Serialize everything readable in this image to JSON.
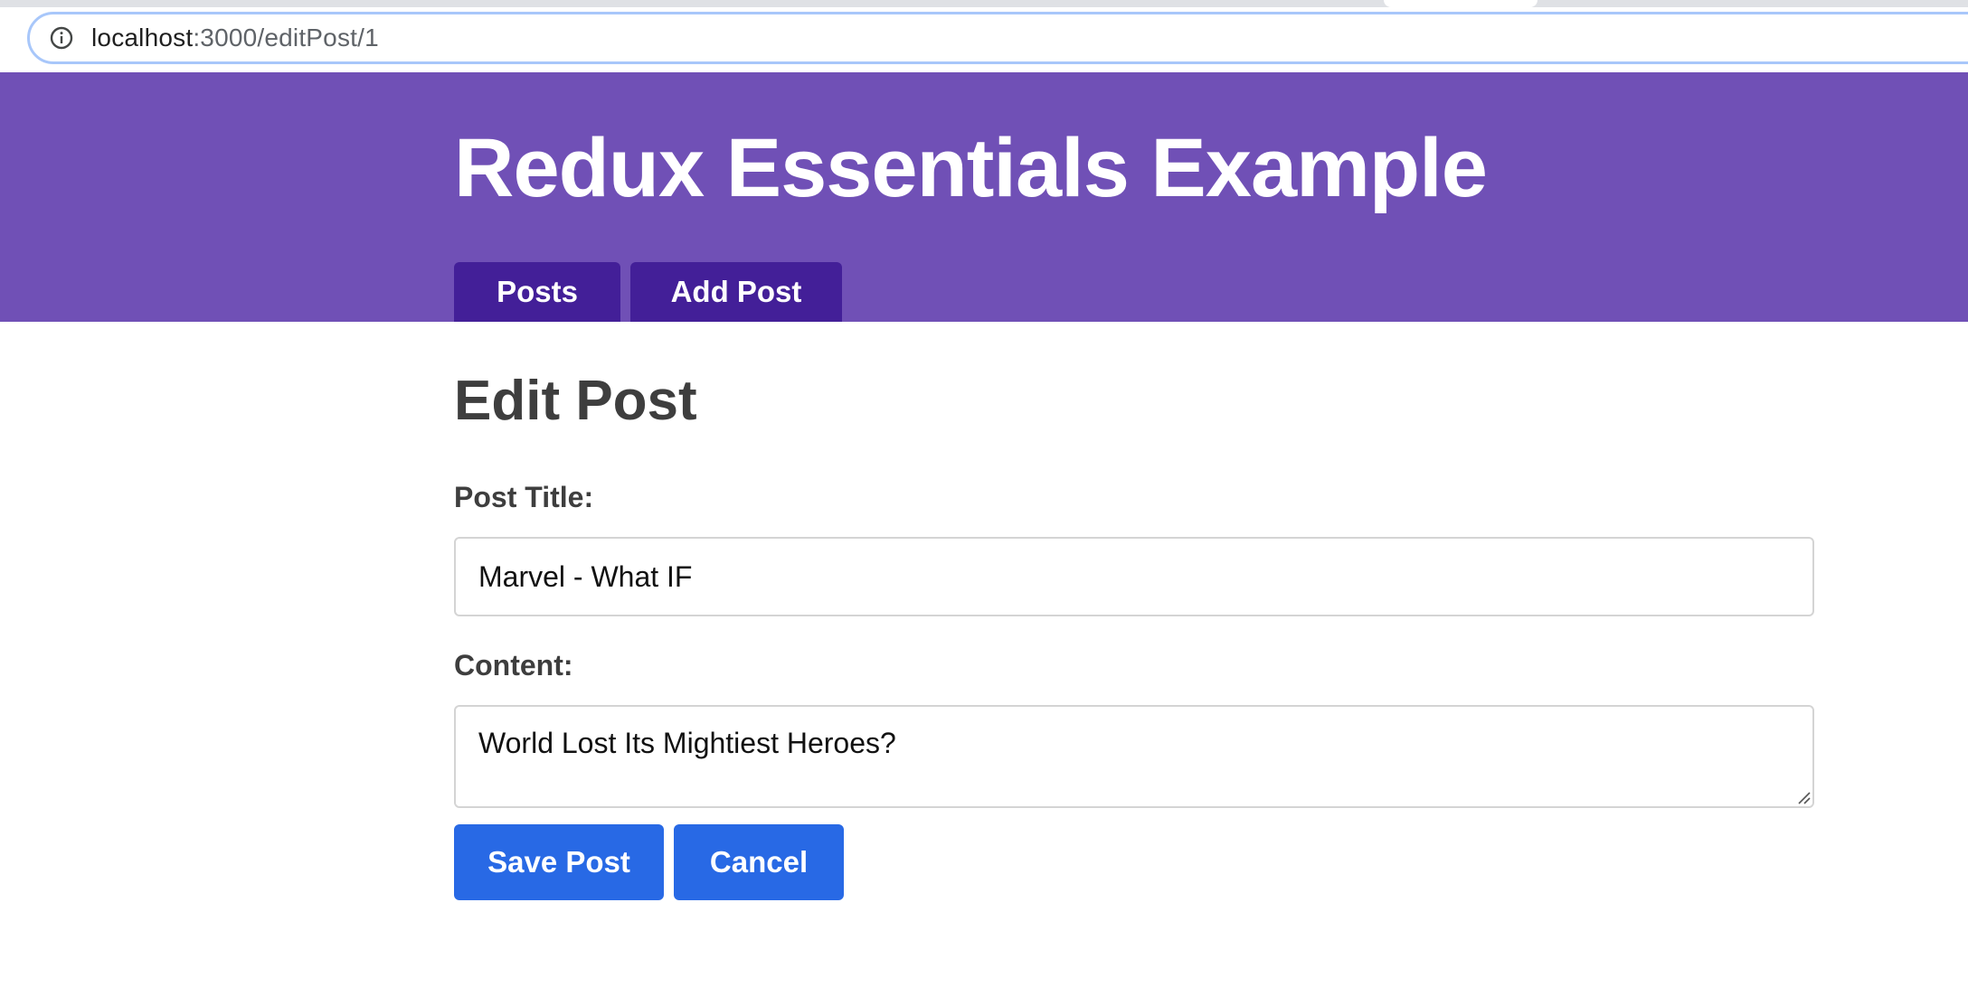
{
  "browser": {
    "url_host": "localhost",
    "url_path": ":3000/editPost/1",
    "info_icon": "info-icon"
  },
  "header": {
    "title": "Redux Essentials Example",
    "nav": [
      {
        "label": "Posts"
      },
      {
        "label": "Add Post"
      }
    ],
    "colors": {
      "background": "#7050b6",
      "nav_button": "#431f98"
    }
  },
  "form": {
    "heading": "Edit Post",
    "title_label": "Post Title:",
    "title_value": "Marvel - What IF",
    "content_label": "Content:",
    "content_value": "World Lost Its Mightiest Heroes?",
    "save_label": "Save Post",
    "cancel_label": "Cancel",
    "button_color": "#2869e5"
  }
}
